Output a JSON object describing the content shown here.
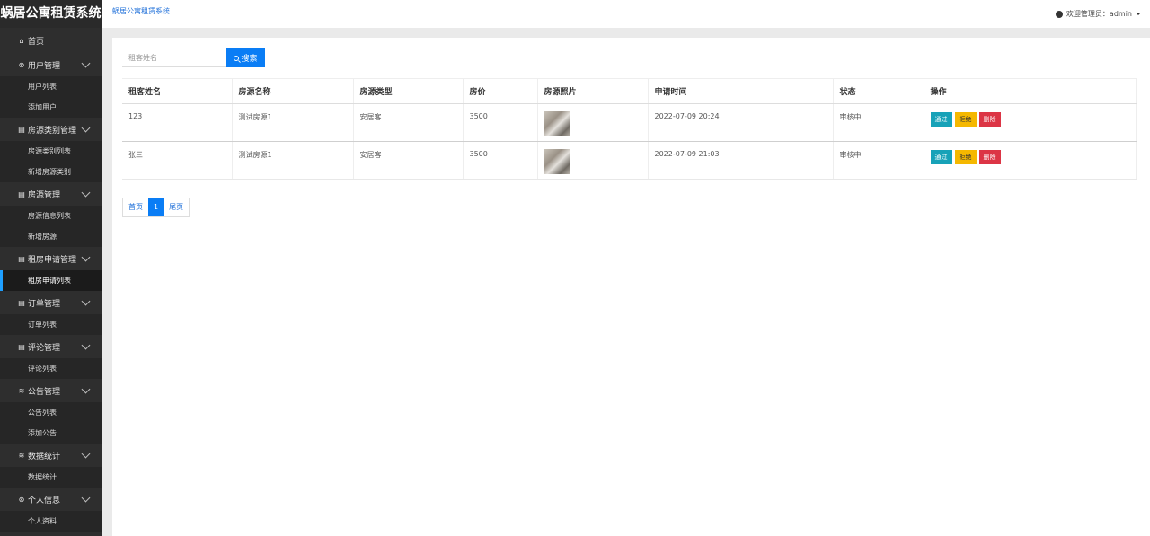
{
  "app": {
    "brand": "蜗居公寓租赁系统",
    "breadcrumb": "蜗居公寓租赁系统",
    "welcome": "欢迎管理员：admin"
  },
  "sidebar": {
    "home": "首页",
    "groups": [
      {
        "label": "用户管理",
        "icon": "users-icon",
        "items": [
          "用户列表",
          "添加用户"
        ]
      },
      {
        "label": "房源类别管理",
        "icon": "doc-icon",
        "items": [
          "房源类别列表",
          "新增房源类别"
        ]
      },
      {
        "label": "房源管理",
        "icon": "doc-icon",
        "items": [
          "房源信息列表",
          "新增房源"
        ]
      },
      {
        "label": "租房申请管理",
        "icon": "doc-icon",
        "items": [
          "租房申请列表"
        ]
      },
      {
        "label": "订单管理",
        "icon": "doc-icon",
        "items": [
          "订单列表"
        ]
      },
      {
        "label": "评论管理",
        "icon": "doc-icon",
        "items": [
          "评论列表"
        ]
      },
      {
        "label": "公告管理",
        "icon": "layers-icon",
        "items": [
          "公告列表",
          "添加公告"
        ]
      },
      {
        "label": "数据统计",
        "icon": "layers-icon",
        "items": [
          "数据统计"
        ]
      },
      {
        "label": "个人信息",
        "icon": "user-icon",
        "items": [
          "个人资料"
        ]
      }
    ],
    "active_item": "租房申请列表"
  },
  "search": {
    "placeholder": "租客姓名",
    "value": "",
    "button": "搜索"
  },
  "table": {
    "headers": [
      "租客姓名",
      "房源名称",
      "房源类型",
      "房价",
      "房源照片",
      "申请时间",
      "状态",
      "操作"
    ],
    "rows": [
      {
        "tenant": "123",
        "house": "测试房源1",
        "type": "安居客",
        "price": "3500",
        "time": "2022-07-09 20:24",
        "status": "审核中"
      },
      {
        "tenant": "张三",
        "house": "测试房源1",
        "type": "安居客",
        "price": "3500",
        "time": "2022-07-09 21:03",
        "status": "审核中"
      }
    ],
    "actions": {
      "pass": "通过",
      "reject": "拒绝",
      "delete": "删除"
    }
  },
  "pager": {
    "first": "首页",
    "current": "1",
    "last": "尾页"
  }
}
